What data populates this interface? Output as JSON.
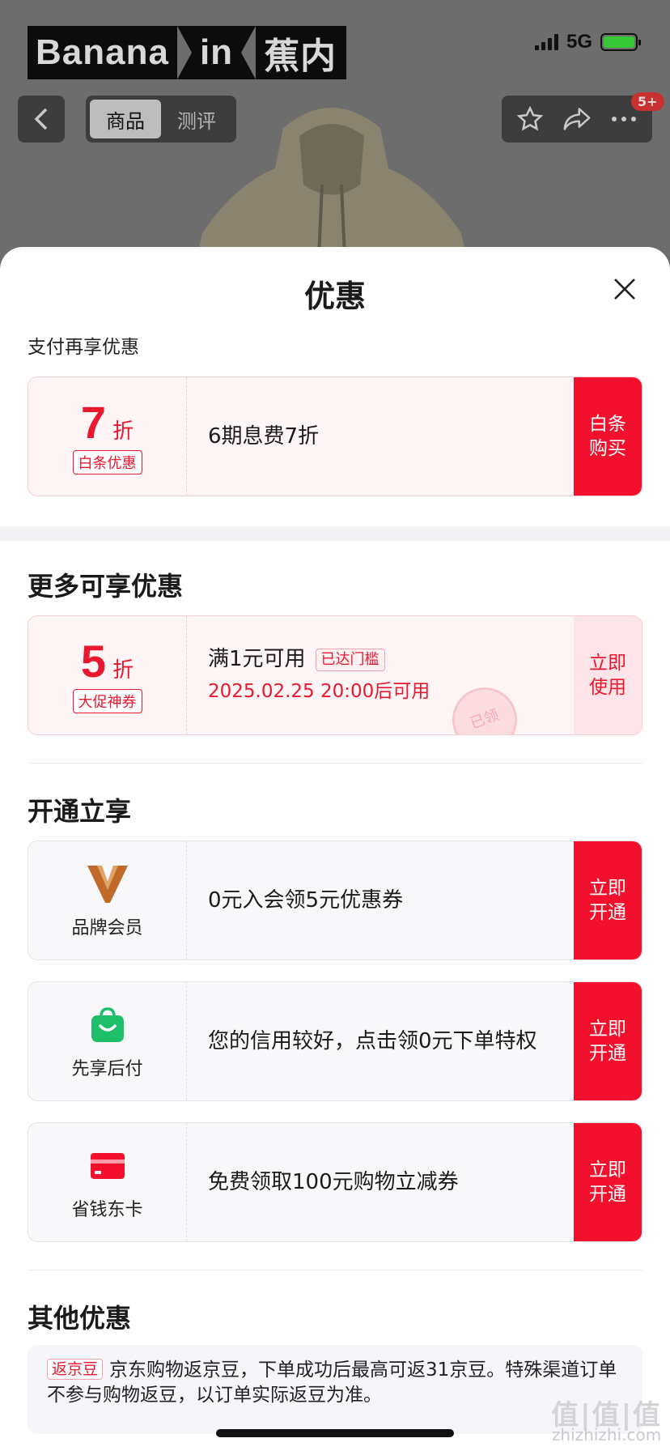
{
  "background": {
    "brand_banner": [
      "Banana",
      "in",
      "蕉内"
    ],
    "status": {
      "network": "5G"
    },
    "tabs": [
      {
        "label": "商品",
        "active": true
      },
      {
        "label": "测评",
        "active": false
      }
    ],
    "badge": "5+"
  },
  "sheet": {
    "title": "优惠",
    "pay_section": {
      "label": "支付再享优惠",
      "card": {
        "discount_num": "7",
        "discount_unit": "折",
        "tag": "白条优惠",
        "text": "6期息费7折",
        "action": "白条\n购买"
      }
    },
    "more_section": {
      "label": "更多可享优惠",
      "card": {
        "discount_num": "5",
        "discount_unit": "折",
        "tag": "大促神券",
        "text": "满1元可用",
        "inline_tag": "已达门槛",
        "valid_text": "2025.02.25 20:00后可用",
        "stamp": "已领",
        "action": "立即\n使用"
      }
    },
    "open_section": {
      "label": "开通立享",
      "cards": [
        {
          "icon": "brand-member-v-icon",
          "icon_label": "品牌会员",
          "text": "0元入会领5元优惠券",
          "action": "立即\n开通"
        },
        {
          "icon": "shopping-bag-icon",
          "icon_label": "先享后付",
          "text": "您的信用较好，点击领0元下单特权",
          "action": "立即\n开通"
        },
        {
          "icon": "red-card-icon",
          "icon_label": "省钱东卡",
          "text": "免费领取100元购物立减券",
          "action": "立即\n开通"
        }
      ]
    },
    "other_section": {
      "label": "其他优惠",
      "tag": "返京豆",
      "text": "京东购物返京豆，下单成功后最高可返31京豆。特殊渠道订单不参与购物返豆，以订单实际返豆为准。"
    }
  },
  "watermark": {
    "big": "值|值|值",
    "small": "zhizhizhi.com"
  },
  "colors": {
    "accent_red": "#f2102c",
    "text_red": "#e8182f",
    "member_gold": "#c06a2a",
    "pay_green": "#1fbf6a"
  }
}
